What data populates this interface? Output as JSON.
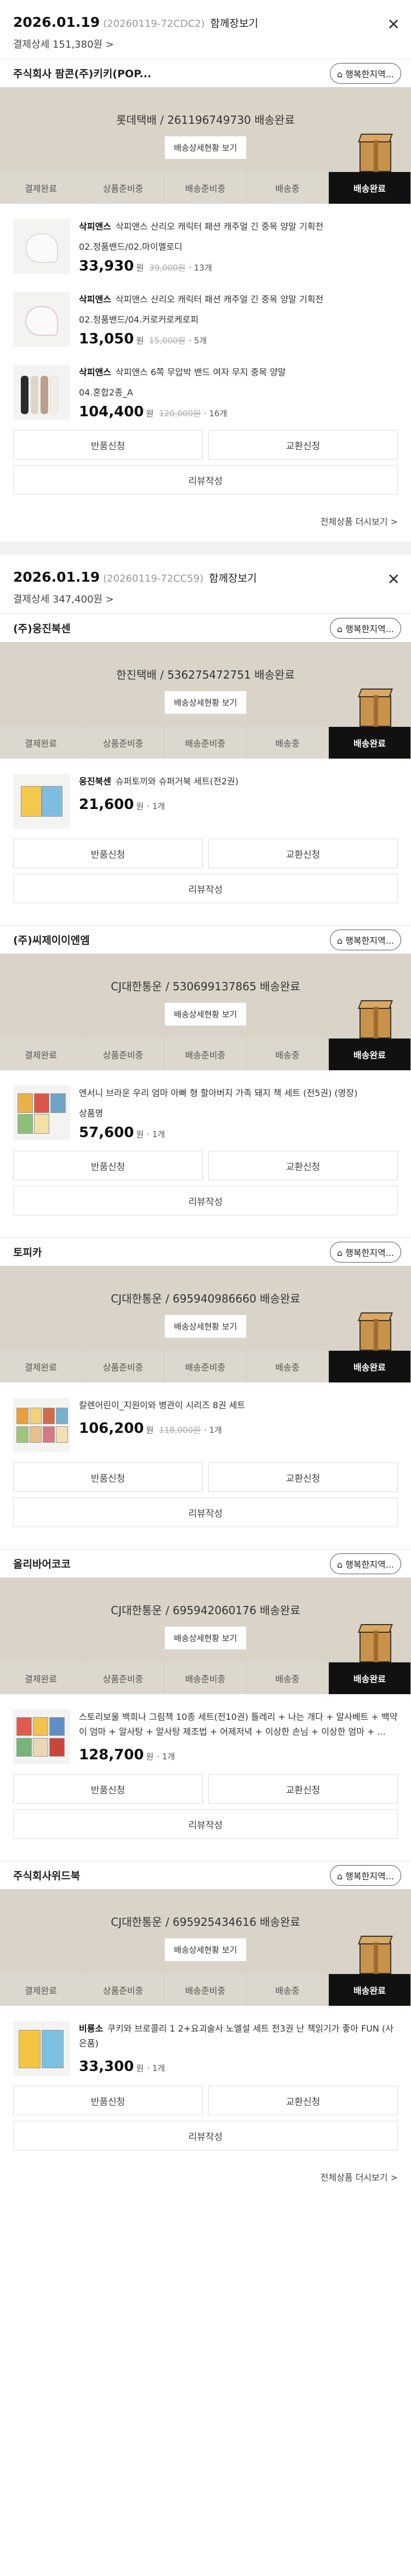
{
  "common": {
    "view_all": "함께장보기",
    "return_label": "반품신청",
    "exchange_label": "교환신청",
    "review_label": "리뷰작성",
    "track_label": "배송상세현황 보기",
    "more_orders": "전체상품 더시보기 >",
    "shop_button": "행복한지역...",
    "won": "원",
    "steps": [
      "결제완료",
      "상품준비중",
      "배송준비중",
      "배송중",
      "배송완료"
    ]
  },
  "orders": [
    {
      "date": "2026.01.19",
      "order_no": "(20260119-72CDC2)",
      "payment": "결제상세 151,380원 >",
      "shop": "주식회사 팜콘(주)키키(POP...",
      "courier": "롯데택배 / 261196749730 배송완료",
      "items": [
        {
          "brand": "삭피앤스",
          "name": "삭피앤스 산리오 캐릭터 패션 캐주얼 긴 중목 양말 기획전",
          "option": "02.정품밴드/02.마이멜로디",
          "price": "33,930",
          "orig": "39,000원",
          "qty": "13개"
        },
        {
          "brand": "삭피앤스",
          "name": "삭피앤스 산리오 캐릭터 패션 캐주얼 긴 중목 양말 기획전",
          "option": "02.정품밴드/04.커로커로케로피",
          "price": "13,050",
          "orig": "15,000원",
          "qty": "5개"
        },
        {
          "brand": "삭피앤스",
          "name": "삭피앤스 6쪽 무압박 밴드 여자 무지 중목 양말",
          "option": "04.혼합2종_A",
          "price": "104,400",
          "orig": "120,000원",
          "qty": "16개"
        }
      ]
    },
    {
      "date": "2026.01.19",
      "order_no": "(20260119-72CC59)",
      "payment": "결제상세 347,400원 >",
      "shops": [
        {
          "shop": "(주)웅진북센",
          "courier": "한진택배 / 536275472751 배송완료",
          "items": [
            {
              "brand": "웅진북센",
              "name": "슈퍼토끼와 슈퍼거북 세트(전2권)",
              "option": "",
              "price": "21,600",
              "orig": "",
              "qty": "1개"
            }
          ]
        },
        {
          "shop": "(주)씨제이이엔엠",
          "courier": "CJ대한통운 / 530699137865 배송완료",
          "items": [
            {
              "brand": "",
              "name": "엔서니 브라운 우리 엄마 아빠 형 할아버지 가족 돼지 책 세트 (전5권) (영장)",
              "option": "상품명",
              "price": "57,600",
              "orig": "",
              "qty": "1개"
            }
          ]
        },
        {
          "shop": "토피카",
          "courier": "CJ대한통운 / 695940986660 배송완료",
          "items": [
            {
              "brand": "",
              "name": "칼렌어린이_지원이와 병관이 시리즈 8권 세트",
              "option": "",
              "price": "106,200",
              "orig": "118,000원",
              "qty": "1개"
            }
          ]
        },
        {
          "shop": "올리바어코코",
          "courier": "CJ대한통운 / 695942060176 배송완료",
          "items": [
            {
              "brand": "",
              "name": "스토리보울 백희나 그림책 10종 세트(전10권) 틀레리 + 나는 개다 + 알사베트 + 백약이 엄마 + 알사탕 + 알사탕 제조법 + 어제저녁 + 이상한 손님 + 이상한 엄마 + ...",
              "option": "",
              "price": "128,700",
              "orig": "",
              "qty": "1개"
            }
          ]
        },
        {
          "shop": "주식회사위드북",
          "courier": "CJ대한통운 / 695925434616 배송완료",
          "items": [
            {
              "brand": "비룡소",
              "name": "쿠키와 브로콜리 1 2+요괴술사 노엘설 세트 전3권 난 책읽기가 좋아 FUN (사은품)",
              "option": "",
              "price": "33,300",
              "orig": "",
              "qty": "1개"
            }
          ]
        }
      ]
    }
  ]
}
